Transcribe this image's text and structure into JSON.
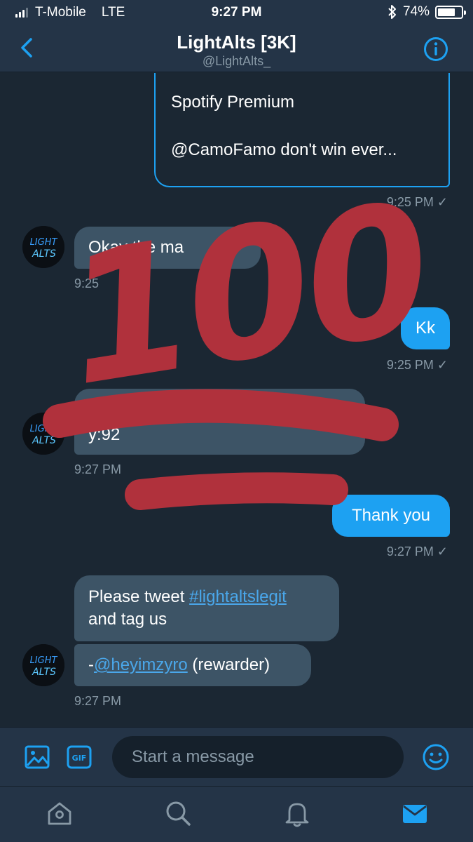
{
  "status_bar": {
    "carrier": "T-Mobile",
    "network": "LTE",
    "time": "9:27 PM",
    "battery": "74%",
    "battery_level": 0.74,
    "icons": [
      "signal-icon",
      "bluetooth-icon",
      "battery-icon"
    ]
  },
  "header": {
    "title": "LightAlts [3K]",
    "handle": "@LightAlts_",
    "icons": [
      "back-chevron-icon",
      "info-icon"
    ]
  },
  "messages": {
    "card": {
      "line1": "Spotify Premium",
      "line2": "@CamoFamo  don't win ever...",
      "time": "9:25 PM ✓"
    },
    "m1": {
      "text": "Okay the ma",
      "time": "9:25"
    },
    "m2": {
      "text": "Kk",
      "time": "9:25 PM ✓"
    },
    "m3": {
      "text_line2": "y:92",
      "time": "9:27 PM"
    },
    "m4": {
      "text": "Thank you",
      "time": "9:27 PM ✓"
    },
    "m5": {
      "prefix": "Please tweet ",
      "hashtag": "#lightaltslegit",
      "line2": "and tag us",
      "time": ""
    },
    "m6": {
      "dash": "-",
      "mention": "@heyimzyro",
      "suffix": " (rewarder)",
      "time": "9:27 PM"
    }
  },
  "avatar": {
    "line1": "LIGHT",
    "line2": "ALTS"
  },
  "overlay": {
    "text": "100",
    "color": "#b0313c"
  },
  "composer": {
    "placeholder": "Start a message",
    "gif_label": "GIF",
    "icons": [
      "image-icon",
      "gif-icon",
      "emoji-icon"
    ]
  },
  "tabbar": {
    "icons": [
      "home-icon",
      "search-icon",
      "notifications-icon",
      "messages-icon"
    ],
    "active": "messages-icon"
  },
  "colors": {
    "background": "#1b2733",
    "header": "#243447",
    "accent": "#1da1f2",
    "incoming_bubble": "#3d5466",
    "muted_text": "#8899a6"
  }
}
